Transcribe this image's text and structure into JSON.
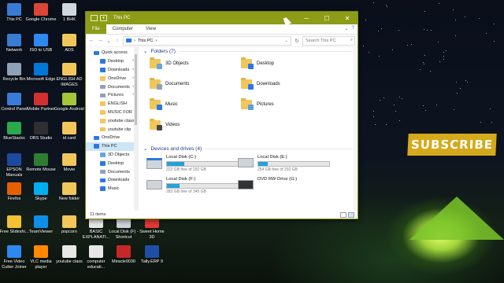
{
  "desktop": {
    "icons_col1": [
      {
        "label": "This PC",
        "icon": "this-pc-icon",
        "color": "#3a7bd5"
      },
      {
        "label": "Network",
        "icon": "network-icon",
        "color": "#3a7bd5"
      },
      {
        "label": "Recycle Bin",
        "icon": "recycle-bin-icon",
        "color": "#8fa2b5"
      },
      {
        "label": "Control Panel",
        "icon": "control-panel-icon",
        "color": "#3a7bd5"
      },
      {
        "label": "BlueStacks",
        "icon": "bluestacks-icon",
        "color": "#2aa84a"
      },
      {
        "label": "EPSON Manuals",
        "icon": "epson-icon",
        "color": "#1d4aa0"
      },
      {
        "label": "Firefox",
        "icon": "firefox-icon",
        "color": "#e66000"
      },
      {
        "label": "Free Slideshi...",
        "icon": "slideshow-icon",
        "color": "#f2c230"
      },
      {
        "label": "Free Video Cutter Joiner",
        "icon": "video-cutter-icon",
        "color": "#2d89ef"
      }
    ],
    "icons_col2": [
      {
        "label": "Google Chrome",
        "icon": "chrome-icon",
        "color": "#db4437"
      },
      {
        "label": "ISO to USB",
        "icon": "iso-usb-icon",
        "color": "#2d89ef"
      },
      {
        "label": "Microsoft Edge",
        "icon": "edge-icon",
        "color": "#0078d7"
      },
      {
        "label": "Mobile Partner",
        "icon": "mobile-partner-icon",
        "color": "#d32f2f"
      },
      {
        "label": "OBS Studio",
        "icon": "obs-icon",
        "color": "#302e31"
      },
      {
        "label": "Remote Mouse",
        "icon": "remote-mouse-icon",
        "color": "#2e7d32"
      },
      {
        "label": "Skype",
        "icon": "skype-icon",
        "color": "#00aff0"
      },
      {
        "label": "TeamViewer",
        "icon": "teamviewer-icon",
        "color": "#0e8ee9"
      },
      {
        "label": "VLC media player",
        "icon": "vlc-icon",
        "color": "#ff8800"
      }
    ],
    "icons_col3": [
      {
        "label": "1 BHK",
        "icon": "file-icon",
        "color": "#cfd6dd"
      },
      {
        "label": "ADS",
        "icon": "folder-icon",
        "color": "#f1c75c"
      },
      {
        "label": "ENGLISH AD IMAGES",
        "icon": "folder-icon",
        "color": "#f1c75c"
      },
      {
        "label": "Google Android",
        "icon": "android-icon",
        "color": "#a4c639"
      },
      {
        "label": "id card",
        "icon": "folder-icon",
        "color": "#f1c75c"
      },
      {
        "label": "Movie",
        "icon": "folder-icon",
        "color": "#f1c75c"
      },
      {
        "label": "New folder",
        "icon": "folder-icon",
        "color": "#f1c75c"
      },
      {
        "label": "popcorn",
        "icon": "folder-icon",
        "color": "#f1c75c"
      },
      {
        "label": "youtube class",
        "icon": "file-icon",
        "color": "#e8e8e8"
      }
    ],
    "bottom_row": [
      {
        "label": "BASIC EXPLANATI...",
        "icon": "doc-icon",
        "color": "#e8e8e8"
      },
      {
        "label": "Local Disk (F) - Shortcut",
        "icon": "disk-shortcut-icon",
        "color": "#cfd4d9"
      },
      {
        "label": "Sweet Home 3D",
        "icon": "sweet-home-icon",
        "color": "#e53935"
      }
    ],
    "bottom_row2": [
      {
        "label": "computer educati...",
        "icon": "doc-icon",
        "color": "#e8e8e8"
      },
      {
        "label": "Miracle9030",
        "icon": "miracle-icon",
        "color": "#c62828"
      },
      {
        "label": "Tally.ERP 9",
        "icon": "tally-icon",
        "color": "#1e4fa5"
      }
    ],
    "subscribe_text": "SUBSCRIBE"
  },
  "window": {
    "title": "This PC",
    "accent": "#8c9c16",
    "tabs": [
      "File",
      "Computer",
      "View"
    ],
    "address_path": "This PC",
    "search_placeholder": "Search This PC",
    "nav": [
      {
        "label": "Quick access",
        "icon": "star-icon",
        "color": "#2b78e4",
        "pinned": false,
        "selected": false
      },
      {
        "label": "Desktop",
        "icon": "desktop-icon",
        "color": "#2b78e4",
        "pinned": true,
        "selected": false
      },
      {
        "label": "Downloads",
        "icon": "downloads-icon",
        "color": "#2b78e4",
        "pinned": true,
        "selected": false
      },
      {
        "label": "OneDrive",
        "icon": "folder-icon",
        "color": "#f1c75c",
        "pinned": true,
        "selected": false
      },
      {
        "label": "Documents",
        "icon": "documents-icon",
        "color": "#8fa2b5",
        "pinned": true,
        "selected": false
      },
      {
        "label": "Pictures",
        "icon": "pictures-icon",
        "color": "#8fa2b5",
        "pinned": true,
        "selected": false
      },
      {
        "label": "ENGLISH",
        "icon": "folder-icon",
        "color": "#f1c75c",
        "pinned": false,
        "selected": false
      },
      {
        "label": "MUSIC FOR YOU",
        "icon": "folder-icon",
        "color": "#f1c75c",
        "pinned": false,
        "selected": false
      },
      {
        "label": "youtube class",
        "icon": "folder-icon",
        "color": "#f1c75c",
        "pinned": false,
        "selected": false
      },
      {
        "label": "youtube clip",
        "icon": "folder-icon",
        "color": "#f1c75c",
        "pinned": false,
        "selected": false
      },
      {
        "label": "OneDrive",
        "icon": "cloud-icon",
        "color": "#2b78e4",
        "pinned": false,
        "selected": false
      },
      {
        "label": "This PC",
        "icon": "this-pc-icon",
        "color": "#2b78e4",
        "pinned": false,
        "selected": true
      },
      {
        "label": "3D Objects",
        "icon": "3d-objects-icon",
        "color": "#6aa6d8",
        "pinned": false,
        "selected": false
      },
      {
        "label": "Desktop",
        "icon": "desktop-icon",
        "color": "#2b78e4",
        "pinned": false,
        "selected": false
      },
      {
        "label": "Documents",
        "icon": "documents-icon",
        "color": "#8fa2b5",
        "pinned": false,
        "selected": false
      },
      {
        "label": "Downloads",
        "icon": "downloads-icon",
        "color": "#2b78e4",
        "pinned": false,
        "selected": false
      },
      {
        "label": "Music",
        "icon": "music-icon",
        "color": "#2b78e4",
        "pinned": false,
        "selected": false
      }
    ],
    "folders_header": "Folders (7)",
    "folders": [
      {
        "label": "3D Objects",
        "icon": "3d-objects-icon",
        "overlay": "#6aa6d8"
      },
      {
        "label": "Desktop",
        "icon": "desktop-icon",
        "overlay": "#2b78e4"
      },
      {
        "label": "Documents",
        "icon": "documents-icon",
        "overlay": "#8fa2b5"
      },
      {
        "label": "Downloads",
        "icon": "downloads-icon",
        "overlay": "#2b78e4"
      },
      {
        "label": "Music",
        "icon": "music-icon",
        "overlay": "#2b78e4"
      },
      {
        "label": "Pictures",
        "icon": "pictures-icon",
        "overlay": "#5aa0d8"
      },
      {
        "label": "Videos",
        "icon": "videos-icon",
        "overlay": "#444444"
      }
    ],
    "drives_header": "Devices and drives (4)",
    "drives": [
      {
        "name": "Local Disk (C:)",
        "free": "222 GB free of 292 GB",
        "used_fraction": 0.24,
        "icon": "windows-drive-icon"
      },
      {
        "name": "Local Disk (E:)",
        "free": "254 GB free of 292 GB",
        "used_fraction": 0.13,
        "icon": "drive-icon"
      },
      {
        "name": "Local Disk (F:)",
        "free": "283 GB free of 345 GB",
        "used_fraction": 0.18,
        "icon": "drive-icon"
      },
      {
        "name": "DVD RW Drive (G:)",
        "free": "",
        "used_fraction": null,
        "icon": "dvd-drive-icon"
      }
    ],
    "status": "11 items"
  }
}
